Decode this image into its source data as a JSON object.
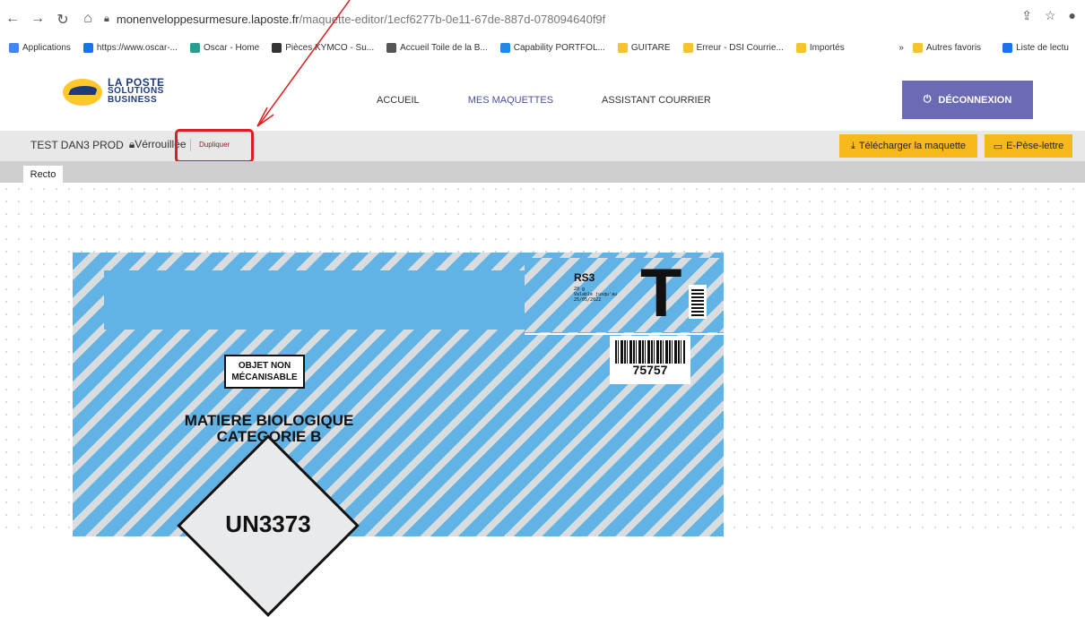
{
  "browser": {
    "url_domain": "monenveloppesurmesure.laposte.fr",
    "url_path": "/maquette-editor/1ecf6277b-0e11-67de-887d-078094640f9f",
    "bookmarks": [
      {
        "label": "Applications",
        "color": "#4285f4"
      },
      {
        "label": "https://www.oscar-...",
        "color": "#1a73e8"
      },
      {
        "label": "Oscar - Home",
        "color": "#2a9d8f"
      },
      {
        "label": "Pièces KYMCO - Su...",
        "color": "#333333"
      },
      {
        "label": "Accueil Toile de la B...",
        "color": "#555555"
      },
      {
        "label": "Capability PORTFOL...",
        "color": "#1e88e5"
      },
      {
        "label": "GUITARE",
        "color": "#f4c430"
      },
      {
        "label": "Erreur - DSI Courrie...",
        "color": "#f4c430"
      },
      {
        "label": "Importés",
        "color": "#f4c430"
      }
    ],
    "bookmarks_right": {
      "more": "»",
      "other": "Autres favoris",
      "reading": "Liste de lectu"
    }
  },
  "header": {
    "logo_line1": "LA POSTE",
    "logo_line2": "SOLUTIONS",
    "logo_line3": "BUSINESS",
    "menu": [
      "ACCUEIL",
      "MES MAQUETTES",
      "ASSISTANT COURRIER"
    ],
    "active_menu": "MES MAQUETTES",
    "logout_label": "DÉCONNEXION"
  },
  "toolbar": {
    "title": "TEST DAN3 PROD",
    "lock_label": "Vérrouillée",
    "duplicate_label": "Dupliquer",
    "download_label": "Télécharger la maquette",
    "pese_label": "E-Pèse-lettre"
  },
  "tabs": {
    "recto": "Recto"
  },
  "envelope": {
    "rs3": "RS3",
    "rs3_sub1": "20 g",
    "rs3_sub2": "Valable jusqu'au",
    "rs3_sub3": "25/05/2022",
    "big_letter": "T",
    "barcode_number": "75757",
    "objet_line1": "OBJET NON",
    "objet_line2": "MÉCANISABLE",
    "matiere_line1": "MATIERE BIOLOGIQUE",
    "matiere_line2": "CATEGORIE B",
    "un_code": "UN3373"
  },
  "colors": {
    "accent": "#6a6bb4",
    "yellow": "#f6b81a",
    "highlight": "#e01e1e",
    "envelope_blue": "#61b3e6"
  }
}
